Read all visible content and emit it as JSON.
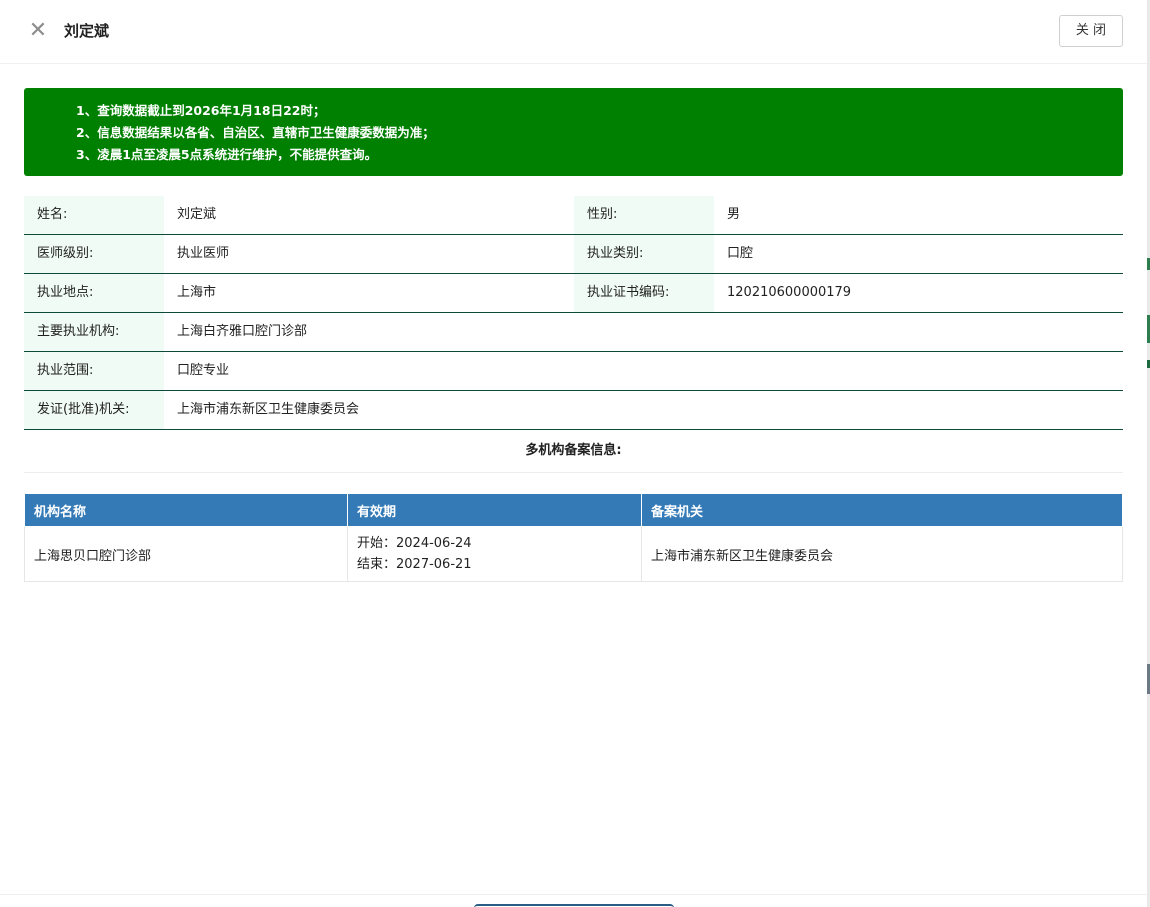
{
  "header": {
    "title": "刘定斌",
    "close_label": "关 闭"
  },
  "notice": {
    "lines": [
      "1、查询数据截止到2026年1月18日22时；",
      "2、信息数据结果以各省、自治区、直辖市卫生健康委数据为准；",
      "3、凌晨1点至凌晨5点系统进行维护，不能提供查询。"
    ]
  },
  "info": {
    "name_label": "姓名:",
    "name": "刘定斌",
    "gender_label": "性别:",
    "gender": "男",
    "level_label": "医师级别:",
    "level": "执业医师",
    "category_label": "执业类别:",
    "category": "口腔",
    "location_label": "执业地点:",
    "location": "上海市",
    "cert_label": "执业证书编码:",
    "cert": "120210600000179",
    "institution_label": "主要执业机构:",
    "institution": "上海白齐雅口腔门诊部",
    "scope_label": "执业范围:",
    "scope": "口腔专业",
    "authority_label": "发证(批准)机关:",
    "authority": "上海市浦东新区卫生健康委员会"
  },
  "multi_org": {
    "title": "多机构备案信息:",
    "headers": [
      "机构名称",
      "有效期",
      "备案机关"
    ],
    "rows": [
      {
        "org": "上海思贝口腔门诊部",
        "start": "开始：2024-06-24",
        "end": "结束：2027-06-21",
        "registrar": "上海市浦东新区卫生健康委员会"
      }
    ]
  }
}
